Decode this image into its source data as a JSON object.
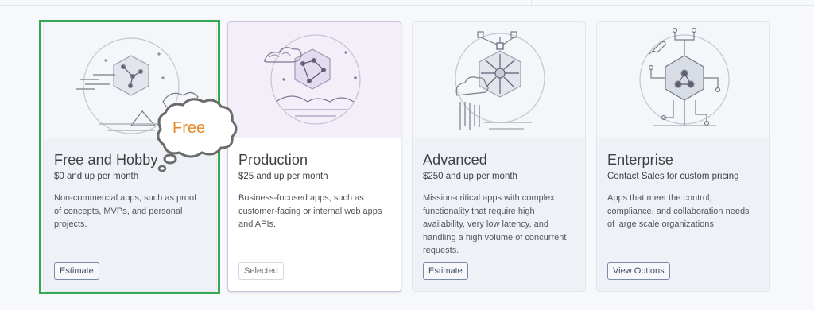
{
  "plans": [
    {
      "name": "Free and Hobby",
      "price": "$0 and up per month",
      "description": "Non-commercial apps, such as proof of concepts, MVPs, and personal projects.",
      "button": "Estimate"
    },
    {
      "name": "Production",
      "price": "$25 and up per month",
      "description": "Business-focused apps, such as customer-facing or internal web apps and APIs.",
      "button": "Selected"
    },
    {
      "name": "Advanced",
      "price": "$250 and up per month",
      "description": "Mission-critical apps with complex functionality that require high availability, very low latency, and handling a high volume of concurrent requests.",
      "button": "Estimate"
    },
    {
      "name": "Enterprise",
      "price": "Contact Sales for custom pricing",
      "description": "Apps that meet the control, compliance, and collaboration needs of large scale organizations.",
      "button": "View Options"
    }
  ],
  "annotation": {
    "bubble_text": "Free",
    "highlight_color": "#33a852",
    "bubble_text_color": "#e38a2c"
  },
  "icons": [
    "constellation-hexagon-icon",
    "cloud-constellation-icon",
    "network-nodes-icon",
    "circuit-rocket-icon"
  ]
}
